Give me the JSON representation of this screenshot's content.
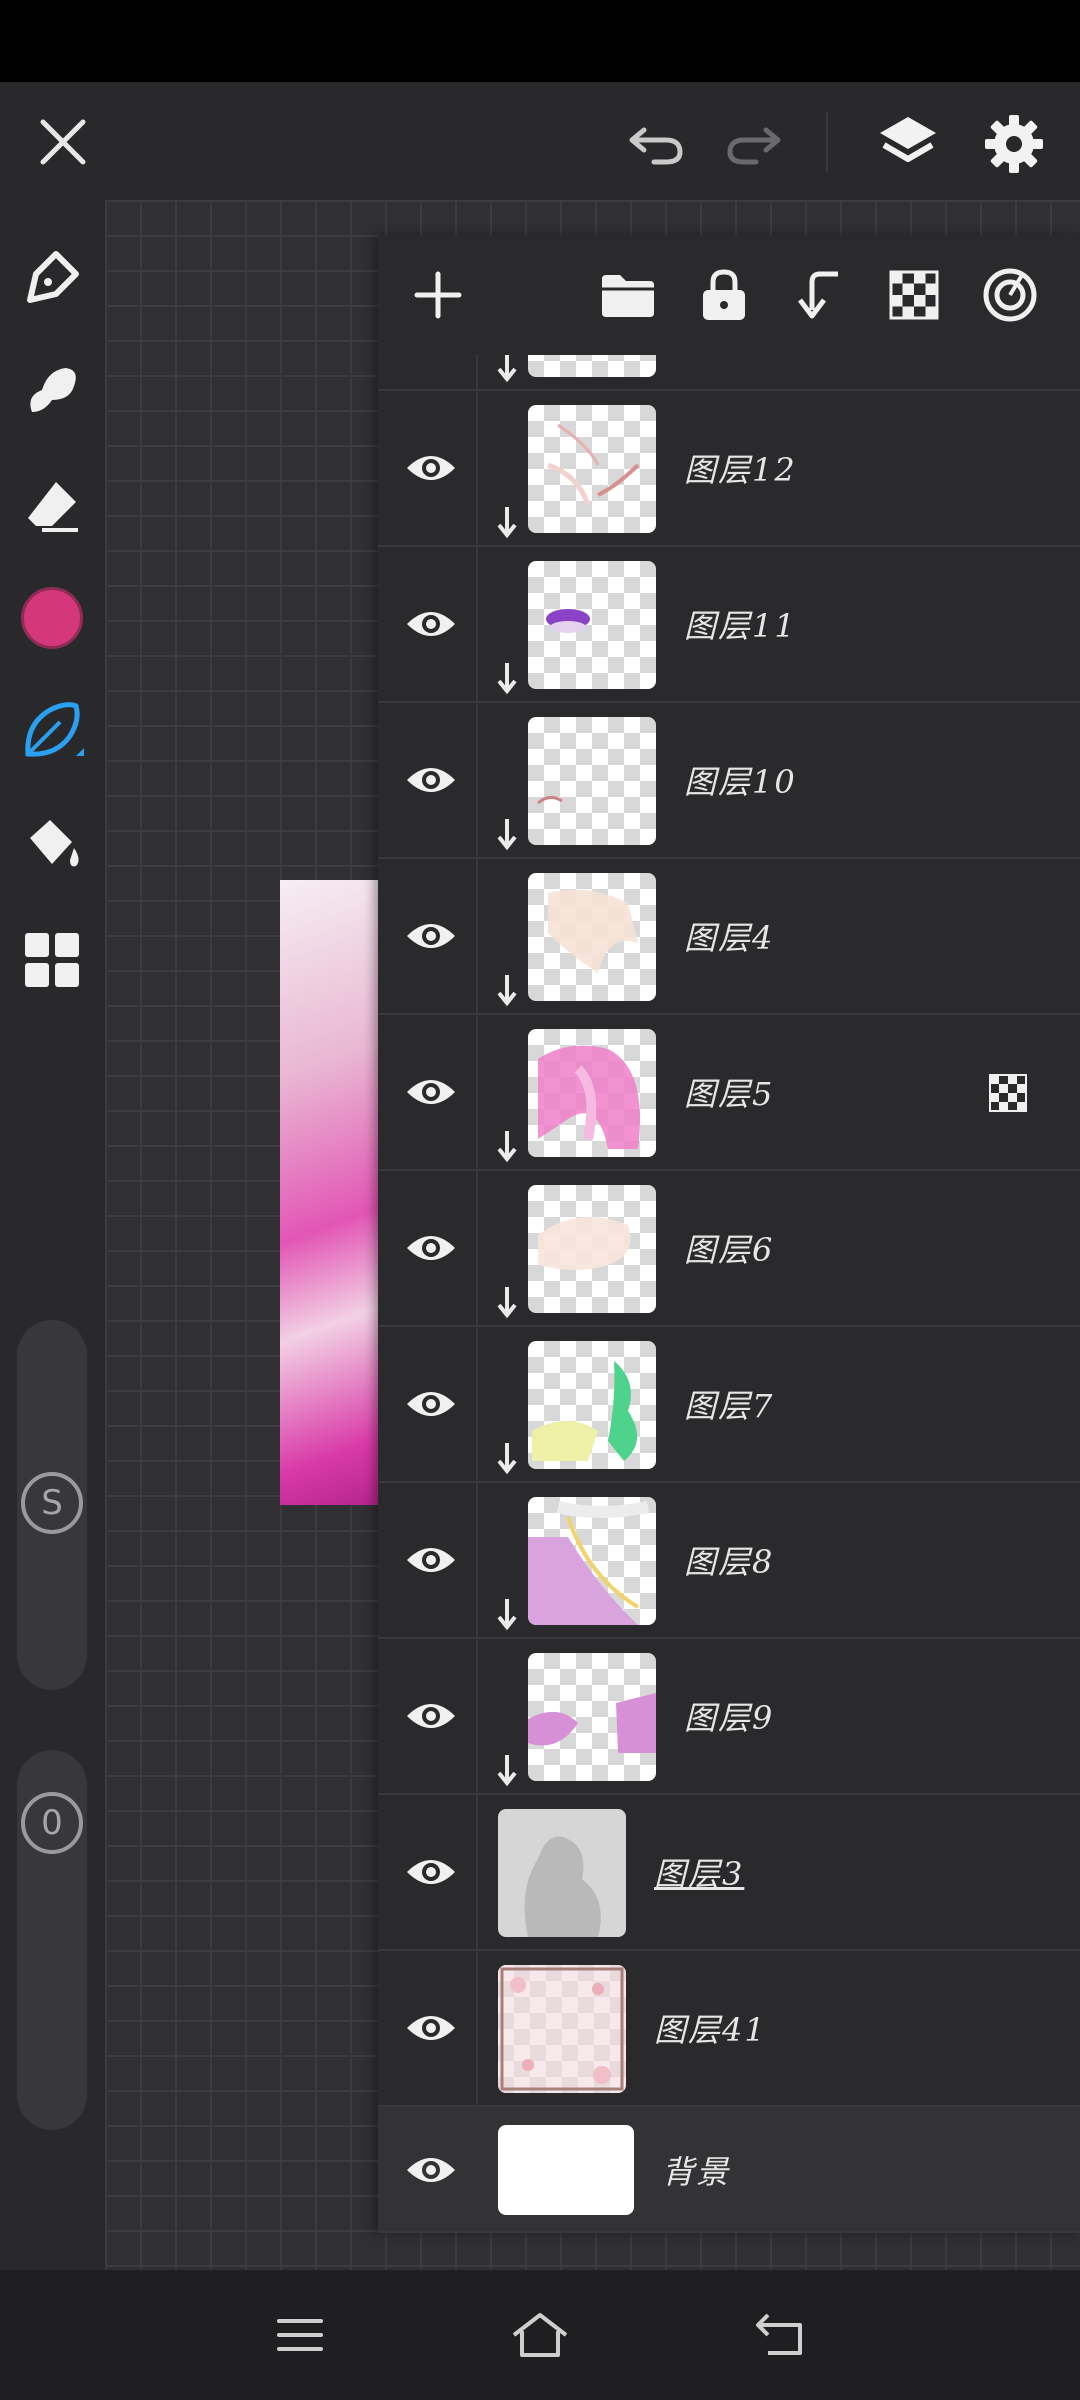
{
  "top_bar": {
    "close_icon": "close-icon",
    "undo_icon": "undo-icon",
    "redo_icon": "redo-icon",
    "layers_icon": "layers-icon",
    "settings_icon": "gear-icon"
  },
  "tools": [
    {
      "name": "pen-tool",
      "icon": "pen-nib-icon"
    },
    {
      "name": "smudge-tool",
      "icon": "smudge-icon"
    },
    {
      "name": "eraser-tool",
      "icon": "eraser-icon"
    },
    {
      "name": "color-picker",
      "icon": "color-swatch",
      "color": "#d4377a"
    },
    {
      "name": "brush-tool",
      "icon": "leaf-brush-icon",
      "active": true,
      "color": "#2aa0f0"
    },
    {
      "name": "fill-tool",
      "icon": "paint-bucket-icon"
    },
    {
      "name": "more-tools",
      "icon": "grid-icon"
    }
  ],
  "sliders": {
    "size_label": "S",
    "opacity_label": "0"
  },
  "layer_panel": {
    "toolbar": [
      {
        "name": "add-layer-button",
        "icon": "plus-icon"
      },
      {
        "name": "folder-button",
        "icon": "folder-icon"
      },
      {
        "name": "lock-button",
        "icon": "lock-icon"
      },
      {
        "name": "clip-button",
        "icon": "clip-down-icon"
      },
      {
        "name": "alpha-button",
        "icon": "checker-icon"
      },
      {
        "name": "target-button",
        "icon": "target-icon"
      }
    ],
    "layers": [
      {
        "label": "图层12",
        "clipped": true
      },
      {
        "label": "图层11",
        "clipped": true
      },
      {
        "label": "图层10",
        "clipped": true
      },
      {
        "label": "图层4",
        "clipped": true
      },
      {
        "label": "图层5",
        "clipped": true,
        "alpha_lock": true
      },
      {
        "label": "图层6",
        "clipped": true
      },
      {
        "label": "图层7",
        "clipped": true
      },
      {
        "label": "图层8",
        "clipped": true
      },
      {
        "label": "图层9",
        "clipped": true
      },
      {
        "label": "图层3",
        "clipped": false,
        "underlined": true
      },
      {
        "label": "图层41",
        "clipped": false
      },
      {
        "label": "背景",
        "clipped": false,
        "selected": true
      }
    ]
  },
  "nav": {
    "menu_icon": "menu-icon",
    "home_icon": "home-icon",
    "back_icon": "back-icon"
  },
  "colors": {
    "accent": "#2aa0f0",
    "brush_color": "#d4377a"
  }
}
